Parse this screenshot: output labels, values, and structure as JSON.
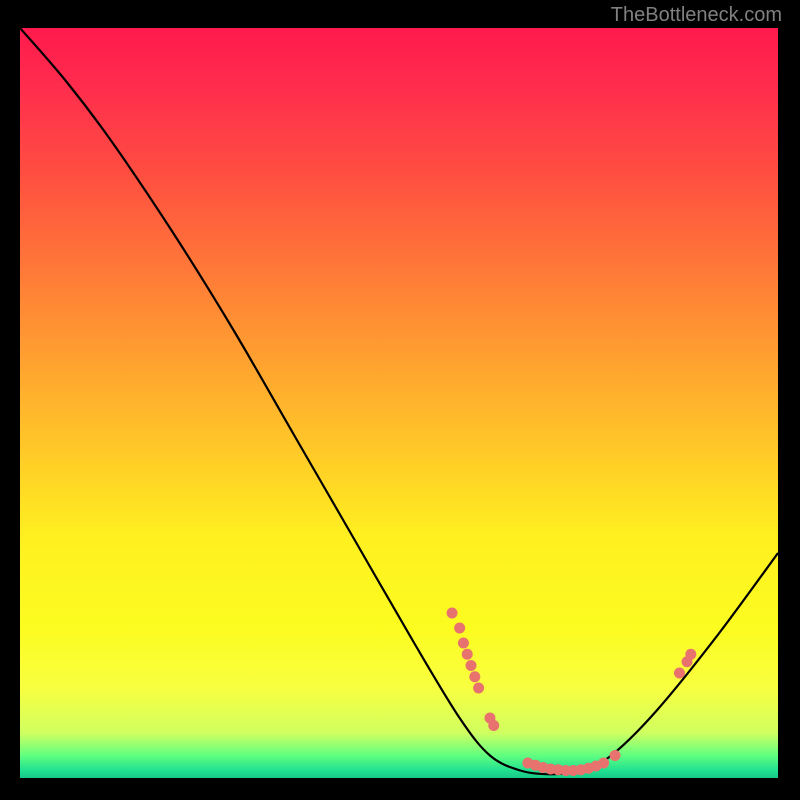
{
  "attribution": "TheBottleneck.com",
  "chart_data": {
    "type": "line",
    "title": "",
    "xlabel": "",
    "ylabel": "",
    "xlim": [
      0,
      100
    ],
    "ylim": [
      0,
      100
    ],
    "curve": [
      {
        "x": 0,
        "y": 100
      },
      {
        "x": 6,
        "y": 93
      },
      {
        "x": 12,
        "y": 85
      },
      {
        "x": 20,
        "y": 73
      },
      {
        "x": 28,
        "y": 60
      },
      {
        "x": 36,
        "y": 46
      },
      {
        "x": 44,
        "y": 32
      },
      {
        "x": 52,
        "y": 18
      },
      {
        "x": 58,
        "y": 8
      },
      {
        "x": 62,
        "y": 3
      },
      {
        "x": 66,
        "y": 1
      },
      {
        "x": 70,
        "y": 0.5
      },
      {
        "x": 74,
        "y": 1
      },
      {
        "x": 78,
        "y": 3
      },
      {
        "x": 84,
        "y": 9
      },
      {
        "x": 92,
        "y": 19
      },
      {
        "x": 100,
        "y": 30
      }
    ],
    "markers": [
      {
        "x": 57,
        "y": 22
      },
      {
        "x": 58,
        "y": 20
      },
      {
        "x": 58.5,
        "y": 18
      },
      {
        "x": 59,
        "y": 16.5
      },
      {
        "x": 59.5,
        "y": 15
      },
      {
        "x": 60,
        "y": 13.5
      },
      {
        "x": 60.5,
        "y": 12
      },
      {
        "x": 62,
        "y": 8
      },
      {
        "x": 62.5,
        "y": 7
      },
      {
        "x": 67,
        "y": 2
      },
      {
        "x": 68,
        "y": 1.7
      },
      {
        "x": 69,
        "y": 1.4
      },
      {
        "x": 70,
        "y": 1.2
      },
      {
        "x": 71,
        "y": 1.1
      },
      {
        "x": 72,
        "y": 1
      },
      {
        "x": 73,
        "y": 1
      },
      {
        "x": 74,
        "y": 1.1
      },
      {
        "x": 75,
        "y": 1.3
      },
      {
        "x": 76,
        "y": 1.6
      },
      {
        "x": 77,
        "y": 2
      },
      {
        "x": 78.5,
        "y": 3
      },
      {
        "x": 87,
        "y": 14
      },
      {
        "x": 88,
        "y": 15.5
      },
      {
        "x": 88.5,
        "y": 16.5
      }
    ],
    "colors": {
      "curve": "#000000",
      "marker": "#e8726e",
      "gradient_top": "#ff1a4d",
      "gradient_bottom": "#18c888"
    }
  }
}
